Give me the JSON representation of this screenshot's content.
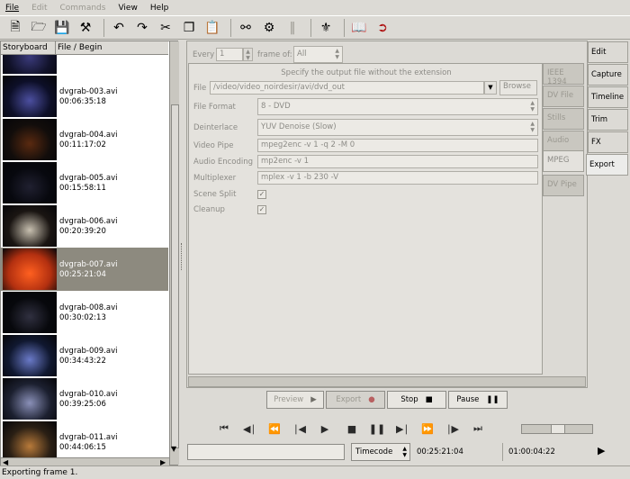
{
  "menu": {
    "file": "File",
    "edit": "Edit",
    "commands": "Commands",
    "view": "View",
    "help": "Help"
  },
  "toolbar": {
    "icons": [
      "new-icon",
      "open-icon",
      "save-icon",
      "preferences-icon",
      "undo-icon",
      "redo-icon",
      "cut-icon",
      "copy-icon",
      "paste-icon",
      "split-scene-icon",
      "join-scenes-icon",
      "cut-range-icon",
      "effects-icon",
      "help-icon",
      "exit-icon"
    ]
  },
  "storyboard": {
    "col_storyboard": "Storyboard",
    "col_file": "File / Begin",
    "items": [
      {
        "file": "",
        "time": ""
      },
      {
        "file": "dvgrab-003.avi",
        "time": "00:06:35:18"
      },
      {
        "file": "dvgrab-004.avi",
        "time": "00:11:17:02"
      },
      {
        "file": "dvgrab-005.avi",
        "time": "00:15:58:11"
      },
      {
        "file": "dvgrab-006.avi",
        "time": "00:20:39:20"
      },
      {
        "file": "dvgrab-007.avi",
        "time": "00:25:21:04"
      },
      {
        "file": "dvgrab-008.avi",
        "time": "00:30:02:13"
      },
      {
        "file": "dvgrab-009.avi",
        "time": "00:34:43:22"
      },
      {
        "file": "dvgrab-010.avi",
        "time": "00:39:25:06"
      },
      {
        "file": "dvgrab-011.avi",
        "time": "00:44:06:15"
      }
    ],
    "selected_index": 5
  },
  "export_panel": {
    "every_label": "Every",
    "every_value": "1",
    "frame_of_label": "frame of:",
    "frame_of_value": "All",
    "hint": "Specify the output file without the extension",
    "file_label": "File",
    "file_value": "/video/video_noirdesir/avi/dvd_out",
    "browse": "Browse",
    "file_format_label": "File Format",
    "file_format_value": "8 - DVD",
    "deinterlace_label": "Deinterlace",
    "deinterlace_value": "YUV Denoise (Slow)",
    "video_pipe_label": "Video Pipe",
    "video_pipe_value": "mpeg2enc -v 1 -q 2 -M 0",
    "audio_encoding_label": "Audio Encoding",
    "audio_encoding_value": "mp2enc -v 1",
    "multiplexer_label": "Multiplexer",
    "multiplexer_value": "mplex -v 1 -b 230 -V",
    "scene_split_label": "Scene Split",
    "scene_split_checked": true,
    "cleanup_label": "Cleanup",
    "cleanup_checked": true
  },
  "export_tabs": [
    "IEEE 1394",
    "DV File",
    "Stills",
    "Audio",
    "MPEG",
    "DV Pipe"
  ],
  "active_export_tab": "MPEG",
  "mode_tabs": [
    "Edit",
    "Capture",
    "Timeline",
    "Trim",
    "FX",
    "Export"
  ],
  "active_mode_tab": "Export",
  "actions": {
    "preview": "Preview",
    "export": "Export",
    "stop": "Stop",
    "pause": "Pause"
  },
  "transport": {
    "timecode_label": "Timecode",
    "position": "00:25:21:04",
    "duration": "01:00:04:22"
  },
  "status": {
    "text": "Exporting frame 1."
  }
}
